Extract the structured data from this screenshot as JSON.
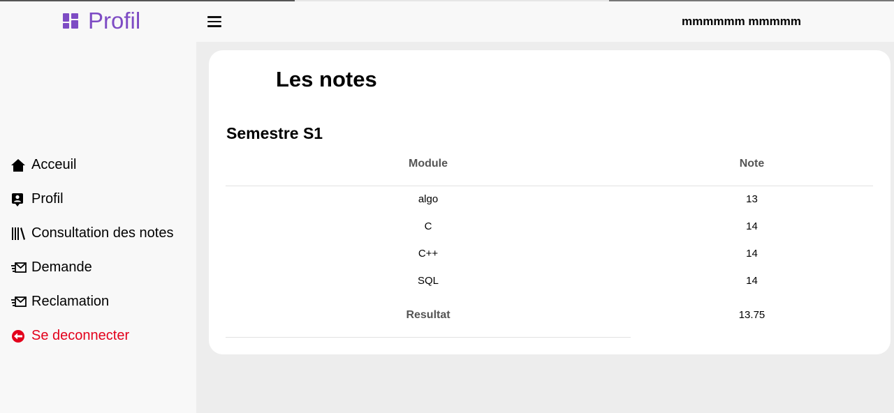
{
  "brand": {
    "title": "Profil",
    "icon": "dashboard-icon",
    "color": "#7e4cc4"
  },
  "header": {
    "username": "mmmmmm mmmmm",
    "menu_icon": "hamburger-icon"
  },
  "sidebar": {
    "items": [
      {
        "label": "Acceuil",
        "icon": "home-icon"
      },
      {
        "label": "Profil",
        "icon": "profile-card-icon"
      },
      {
        "label": "Consultation des notes",
        "icon": "books-icon"
      },
      {
        "label": "Demande",
        "icon": "send-mail-icon"
      },
      {
        "label": "Reclamation",
        "icon": "send-mail-icon"
      },
      {
        "label": "Se deconnecter",
        "icon": "logout-icon",
        "color": "#e3001b"
      }
    ]
  },
  "main": {
    "title": "Les notes",
    "semester": "Semestre S1",
    "table": {
      "headers": [
        "Module",
        "Note"
      ],
      "rows": [
        {
          "module": "algo",
          "note": "13"
        },
        {
          "module": "C",
          "note": "14"
        },
        {
          "module": "C++",
          "note": "14"
        },
        {
          "module": "SQL",
          "note": "14"
        }
      ],
      "result": {
        "label": "Resultat",
        "value": "13.75"
      }
    }
  }
}
